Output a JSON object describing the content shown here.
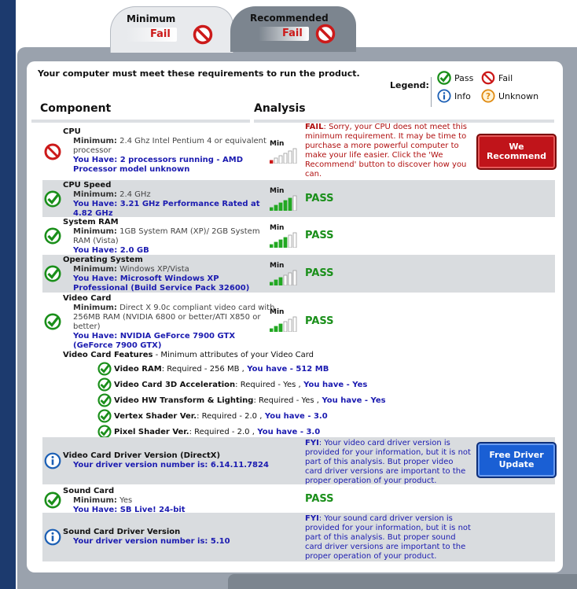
{
  "tabs": {
    "minimum": {
      "title": "Minimum",
      "status": "Fail"
    },
    "recommended": {
      "title": "Recommended",
      "status": "Fail"
    }
  },
  "intro": "Your computer must meet these requirements to run the product.",
  "legend": {
    "label": "Legend:",
    "pass": "Pass",
    "fail": "Fail",
    "info": "Info",
    "unknown": "Unknown"
  },
  "columns": {
    "component": "Component",
    "analysis": "Analysis"
  },
  "meter_label": "Min",
  "rows": {
    "cpu": {
      "title": "CPU",
      "min_label": "Minimum:",
      "min_value": "2.4 Ghz Intel Pentium 4 or equivalent processor",
      "have_text": "You Have: 2 processors running - AMD Processor model unknown",
      "meter_level": 1,
      "fail_lead": "FAIL",
      "fail_msg": ": Sorry, your CPU does not meet this minimum requirement. It may be time to purchase a more powerful computer to make your life easier. Click the 'We Recommend' button to discover how you can.",
      "button": "We Recommend"
    },
    "cpu_speed": {
      "title": "CPU Speed",
      "min_label": "Minimum:",
      "min_value": "2.4 GHz",
      "have_text": "You Have: 3.21 GHz Performance Rated at 4.82 GHz",
      "meter_level": 5,
      "result": "PASS"
    },
    "ram": {
      "title": "System RAM",
      "min_label": "Minimum:",
      "min_value": "1GB System RAM (XP)/ 2GB System RAM (Vista)",
      "have_text": "You Have: 2.0 GB",
      "meter_level": 4,
      "result": "PASS"
    },
    "os": {
      "title": "Operating System",
      "min_label": "Minimum:",
      "min_value": "Windows XP/Vista",
      "have_text": "You Have: Microsoft Windows XP Professional (Build Service Pack 32600)",
      "meter_level": 3,
      "result": "PASS"
    },
    "video": {
      "title": "Video Card",
      "min_label": "Minimum:",
      "min_value": "Direct X 9.0c compliant video card with 256MB RAM (NVIDIA 6800 or better/ATI X850 or better)",
      "have_text": "You Have: NVIDIA GeForce 7900 GTX (GeForce 7900 GTX)",
      "meter_level": 3,
      "result": "PASS"
    },
    "features": {
      "title": "Video Card Features",
      "subtitle": " - Minimum attributes of your Video Card",
      "items": [
        {
          "name": "Video RAM",
          "req": ": Required - 256 MB ,",
          "have": " You have - 512 MB"
        },
        {
          "name": "Video Card 3D Acceleration",
          "req": ": Required - Yes ,",
          "have": " You have - Yes"
        },
        {
          "name": "Video HW Transform & Lighting",
          "req": ": Required - Yes ,",
          "have": " You have - Yes"
        },
        {
          "name": "Vertex Shader Ver.",
          "req": ": Required - 2.0 ,",
          "have": " You have - 3.0"
        },
        {
          "name": "Pixel Shader Ver.",
          "req": ": Required - 2.0 ,",
          "have": " You have - 3.0"
        }
      ]
    },
    "driver": {
      "title": "Video Card Driver Version (DirectX)",
      "have_text": "Your driver version number is: 6.14.11.7824",
      "fyi_lead": "FYI",
      "fyi_msg": ": Your video card driver version is provided for your information, but it is not part of this analysis. But proper video card driver versions are important to the proper operation of your product.",
      "button": "Free Driver Update"
    },
    "sound": {
      "title": "Sound Card",
      "min_label": "Minimum:",
      "min_value": "Yes",
      "have_text": "You Have: SB Live! 24-bit",
      "result": "PASS"
    },
    "sound_driver": {
      "title": "Sound Card Driver Version",
      "have_text": "Your driver version number is: 5.10",
      "fyi_lead": "FYI",
      "fyi_msg": ": Your sound card driver version is provided for your information, but it is not part of this analysis. But proper sound card driver versions are important to the proper operation of your product."
    }
  },
  "colors": {
    "pass_green": "#1a8f1a",
    "fail_red": "#cc1a1a",
    "have_blue": "#1b1bb0",
    "nav_dark": "#1c3a6e"
  }
}
